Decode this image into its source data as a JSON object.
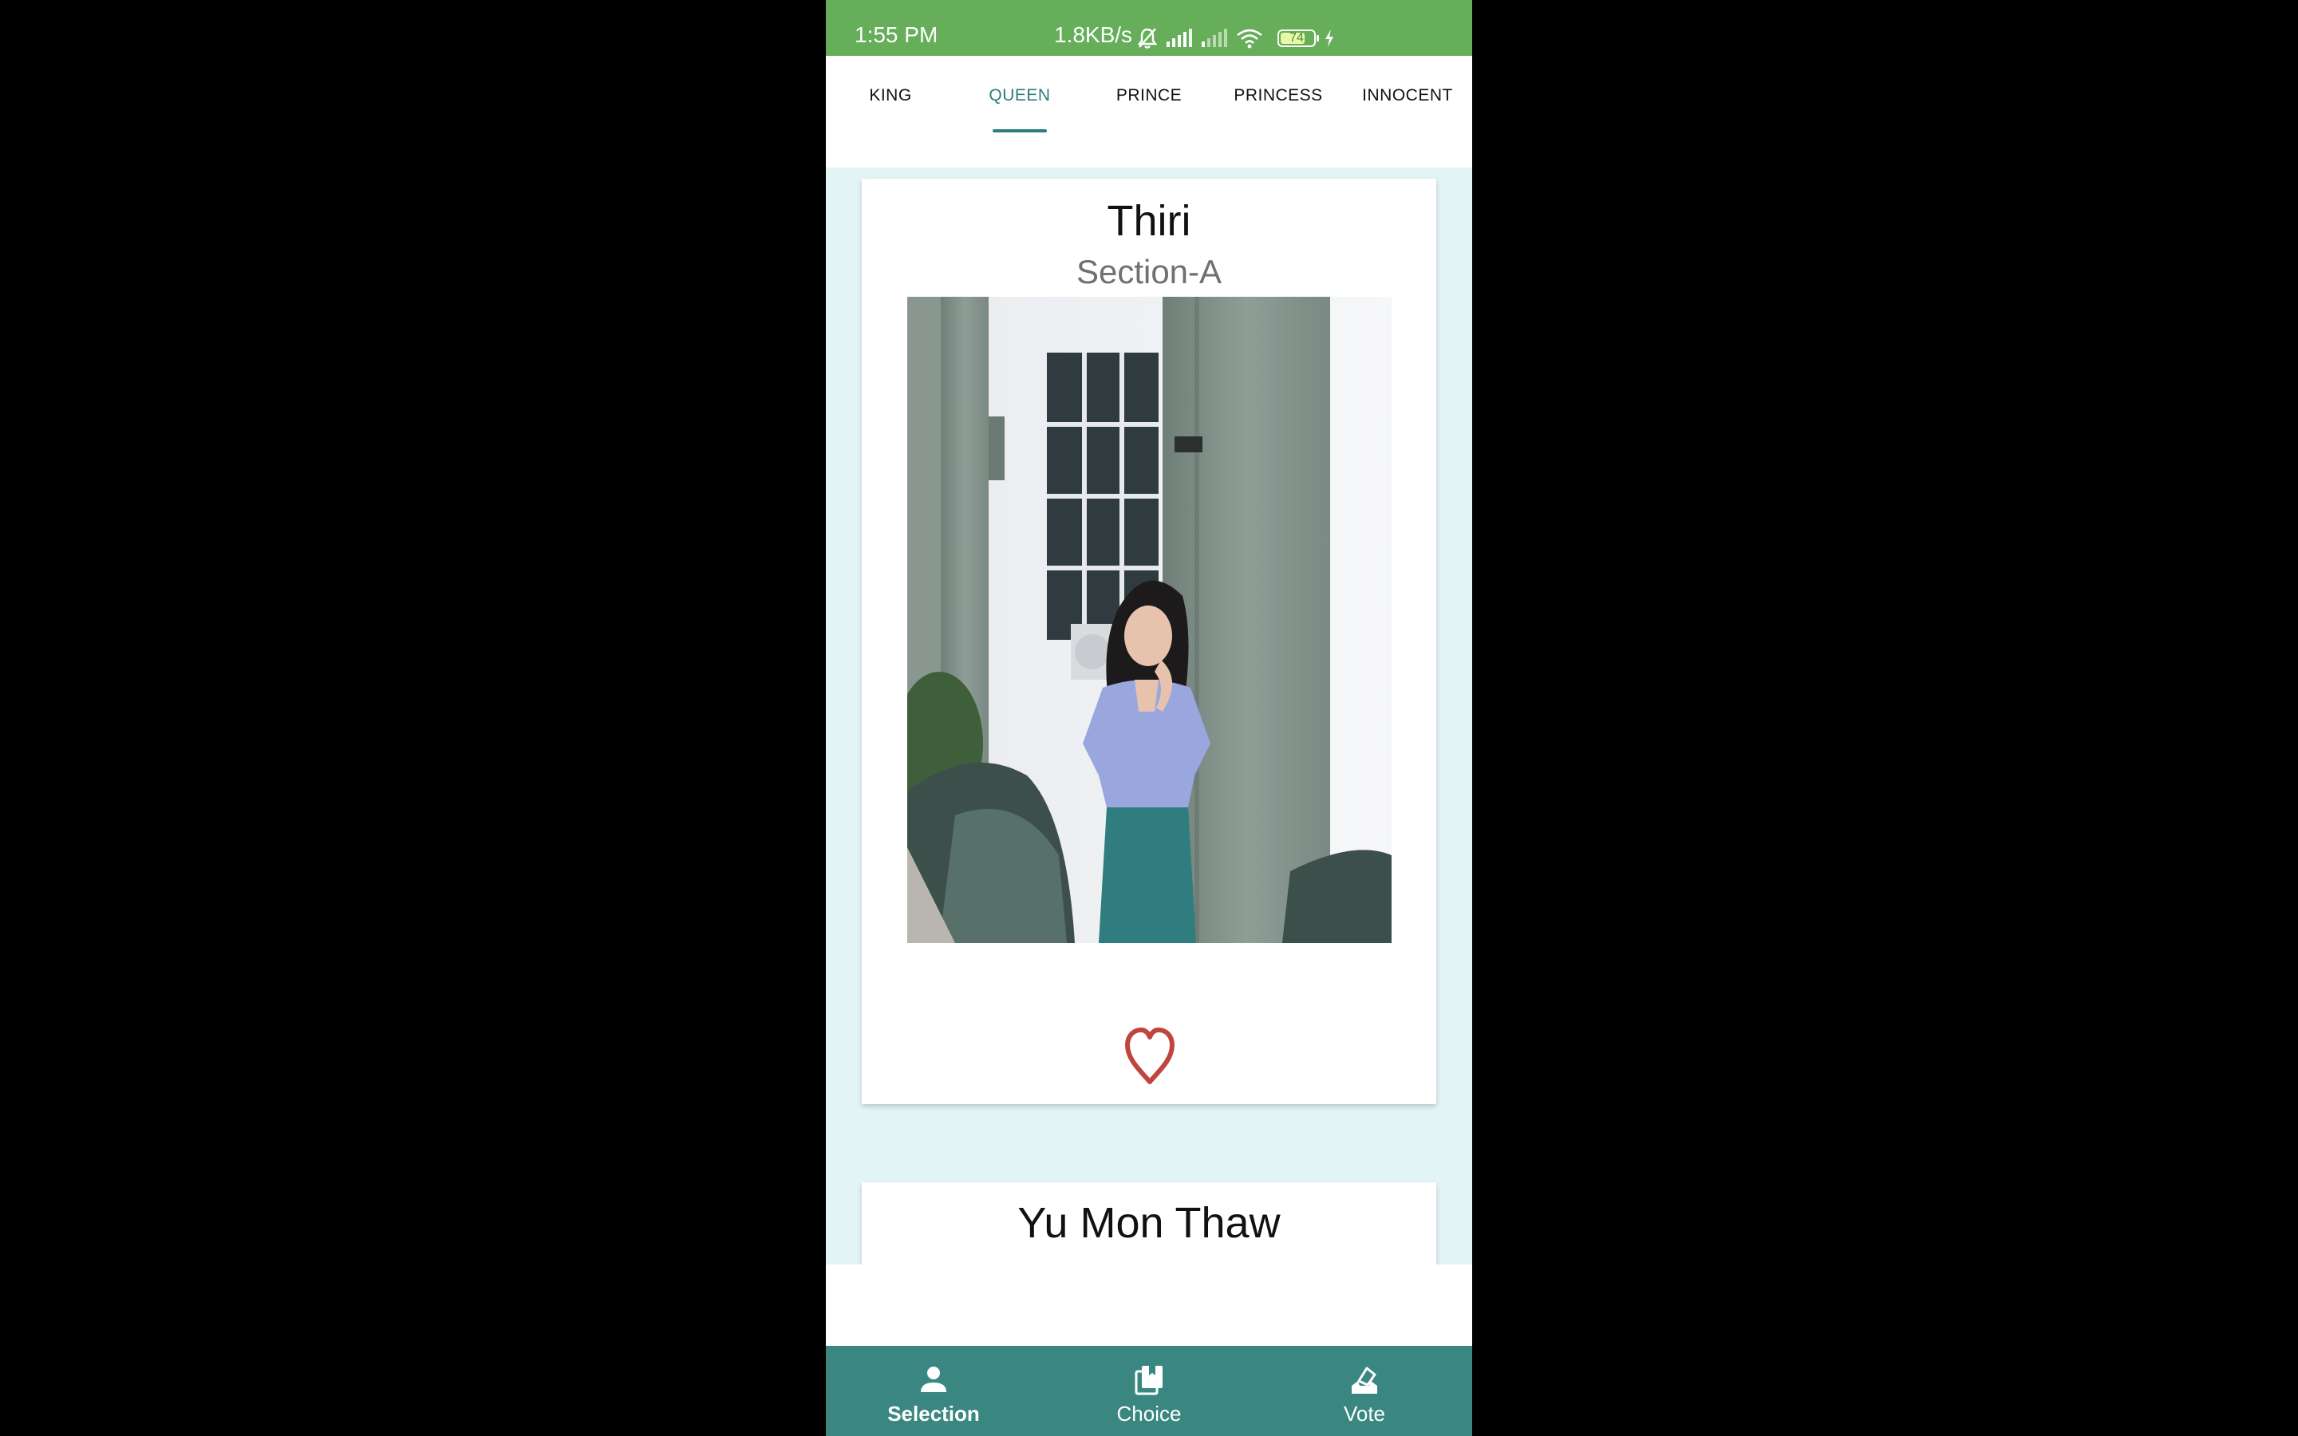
{
  "status_bar": {
    "time": "1:55 PM",
    "network_speed": "1.8KB/s",
    "battery_level": "74",
    "battery_fraction": 0.74,
    "icons": [
      "bell-muted-icon",
      "signal-icon",
      "signal-weak-icon",
      "wifi-icon",
      "battery-icon",
      "charging-icon"
    ]
  },
  "tabs": [
    {
      "label": "KING"
    },
    {
      "label": "QUEEN",
      "active": true
    },
    {
      "label": "PRINCE"
    },
    {
      "label": "PRINCESS"
    },
    {
      "label": "INNOCENT"
    }
  ],
  "candidates": [
    {
      "name": "Thiri",
      "section": "Section-A",
      "photo": "candidate-photo",
      "vote_icon": "heart-outline-icon"
    },
    {
      "name": "Yu Mon Thaw"
    }
  ],
  "bottom_nav": [
    {
      "label": "Selection",
      "icon": "person-icon",
      "active": true
    },
    {
      "label": "Choice",
      "icon": "book-icon"
    },
    {
      "label": "Vote",
      "icon": "ballot-icon"
    }
  ],
  "colors": {
    "status_bar": "#66ae5a",
    "accent": "#2c7e7a",
    "content_background": "#e3f4f5",
    "bottom_nav": "#3a8781",
    "heart": "#c0453d"
  }
}
